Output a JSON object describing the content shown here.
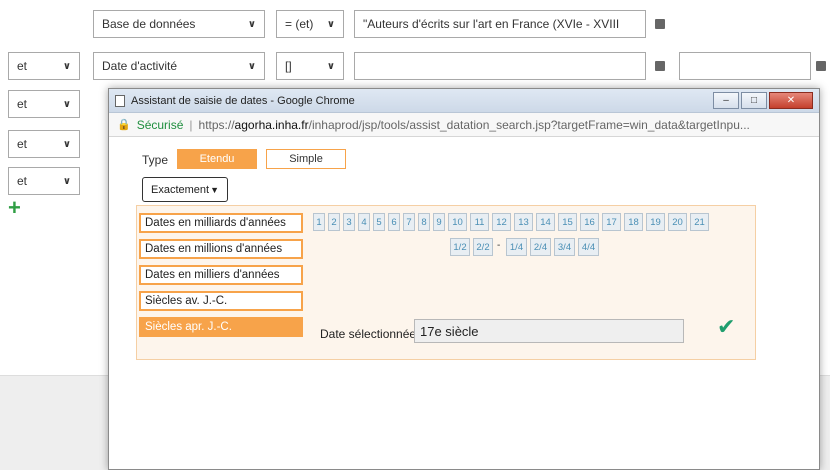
{
  "form": {
    "row1": {
      "field": "Base de données",
      "op": "= (et)",
      "value": "\"Auteurs d'écrits sur l'art en France (XVIe - XVIII"
    },
    "row2": {
      "logic": "et",
      "field": "Date d'activité",
      "op": "[]"
    },
    "row3": {
      "logic": "et"
    },
    "row4": {
      "logic": "et"
    },
    "row5": {
      "logic": "et"
    }
  },
  "popup": {
    "title": "Assistant de saisie de dates - Google Chrome",
    "secure_label": "Sécurisé",
    "url_scheme": "https://",
    "url_host": "agorha.inha.fr",
    "url_path": "/inhaprod/jsp/tools/assist_datation_search.jsp?targetFrame=win_data&targetInpu..."
  },
  "assistant": {
    "type_label": "Type",
    "type_etendu": "Etendu",
    "type_simple": "Simple",
    "mode_select": "Exactement",
    "categories": [
      "Dates en milliards d'années",
      "Dates en millions d'années",
      "Dates en milliers d'années",
      "Siècles av. J.-C.",
      "Siècles apr. J.-C."
    ],
    "active_category_index": 4,
    "numbers": [
      "1",
      "2",
      "3",
      "4",
      "5",
      "6",
      "7",
      "8",
      "9",
      "10",
      "11",
      "12",
      "13",
      "14",
      "15",
      "16",
      "17",
      "18",
      "19",
      "20",
      "21"
    ],
    "fractions_left": [
      "1/2",
      "2/2"
    ],
    "fractions_dash": "-",
    "fractions_right": [
      "1/4",
      "2/4",
      "3/4",
      "4/4"
    ],
    "selected_label": "Date sélectionnée",
    "selected_value": "17e siècle"
  }
}
